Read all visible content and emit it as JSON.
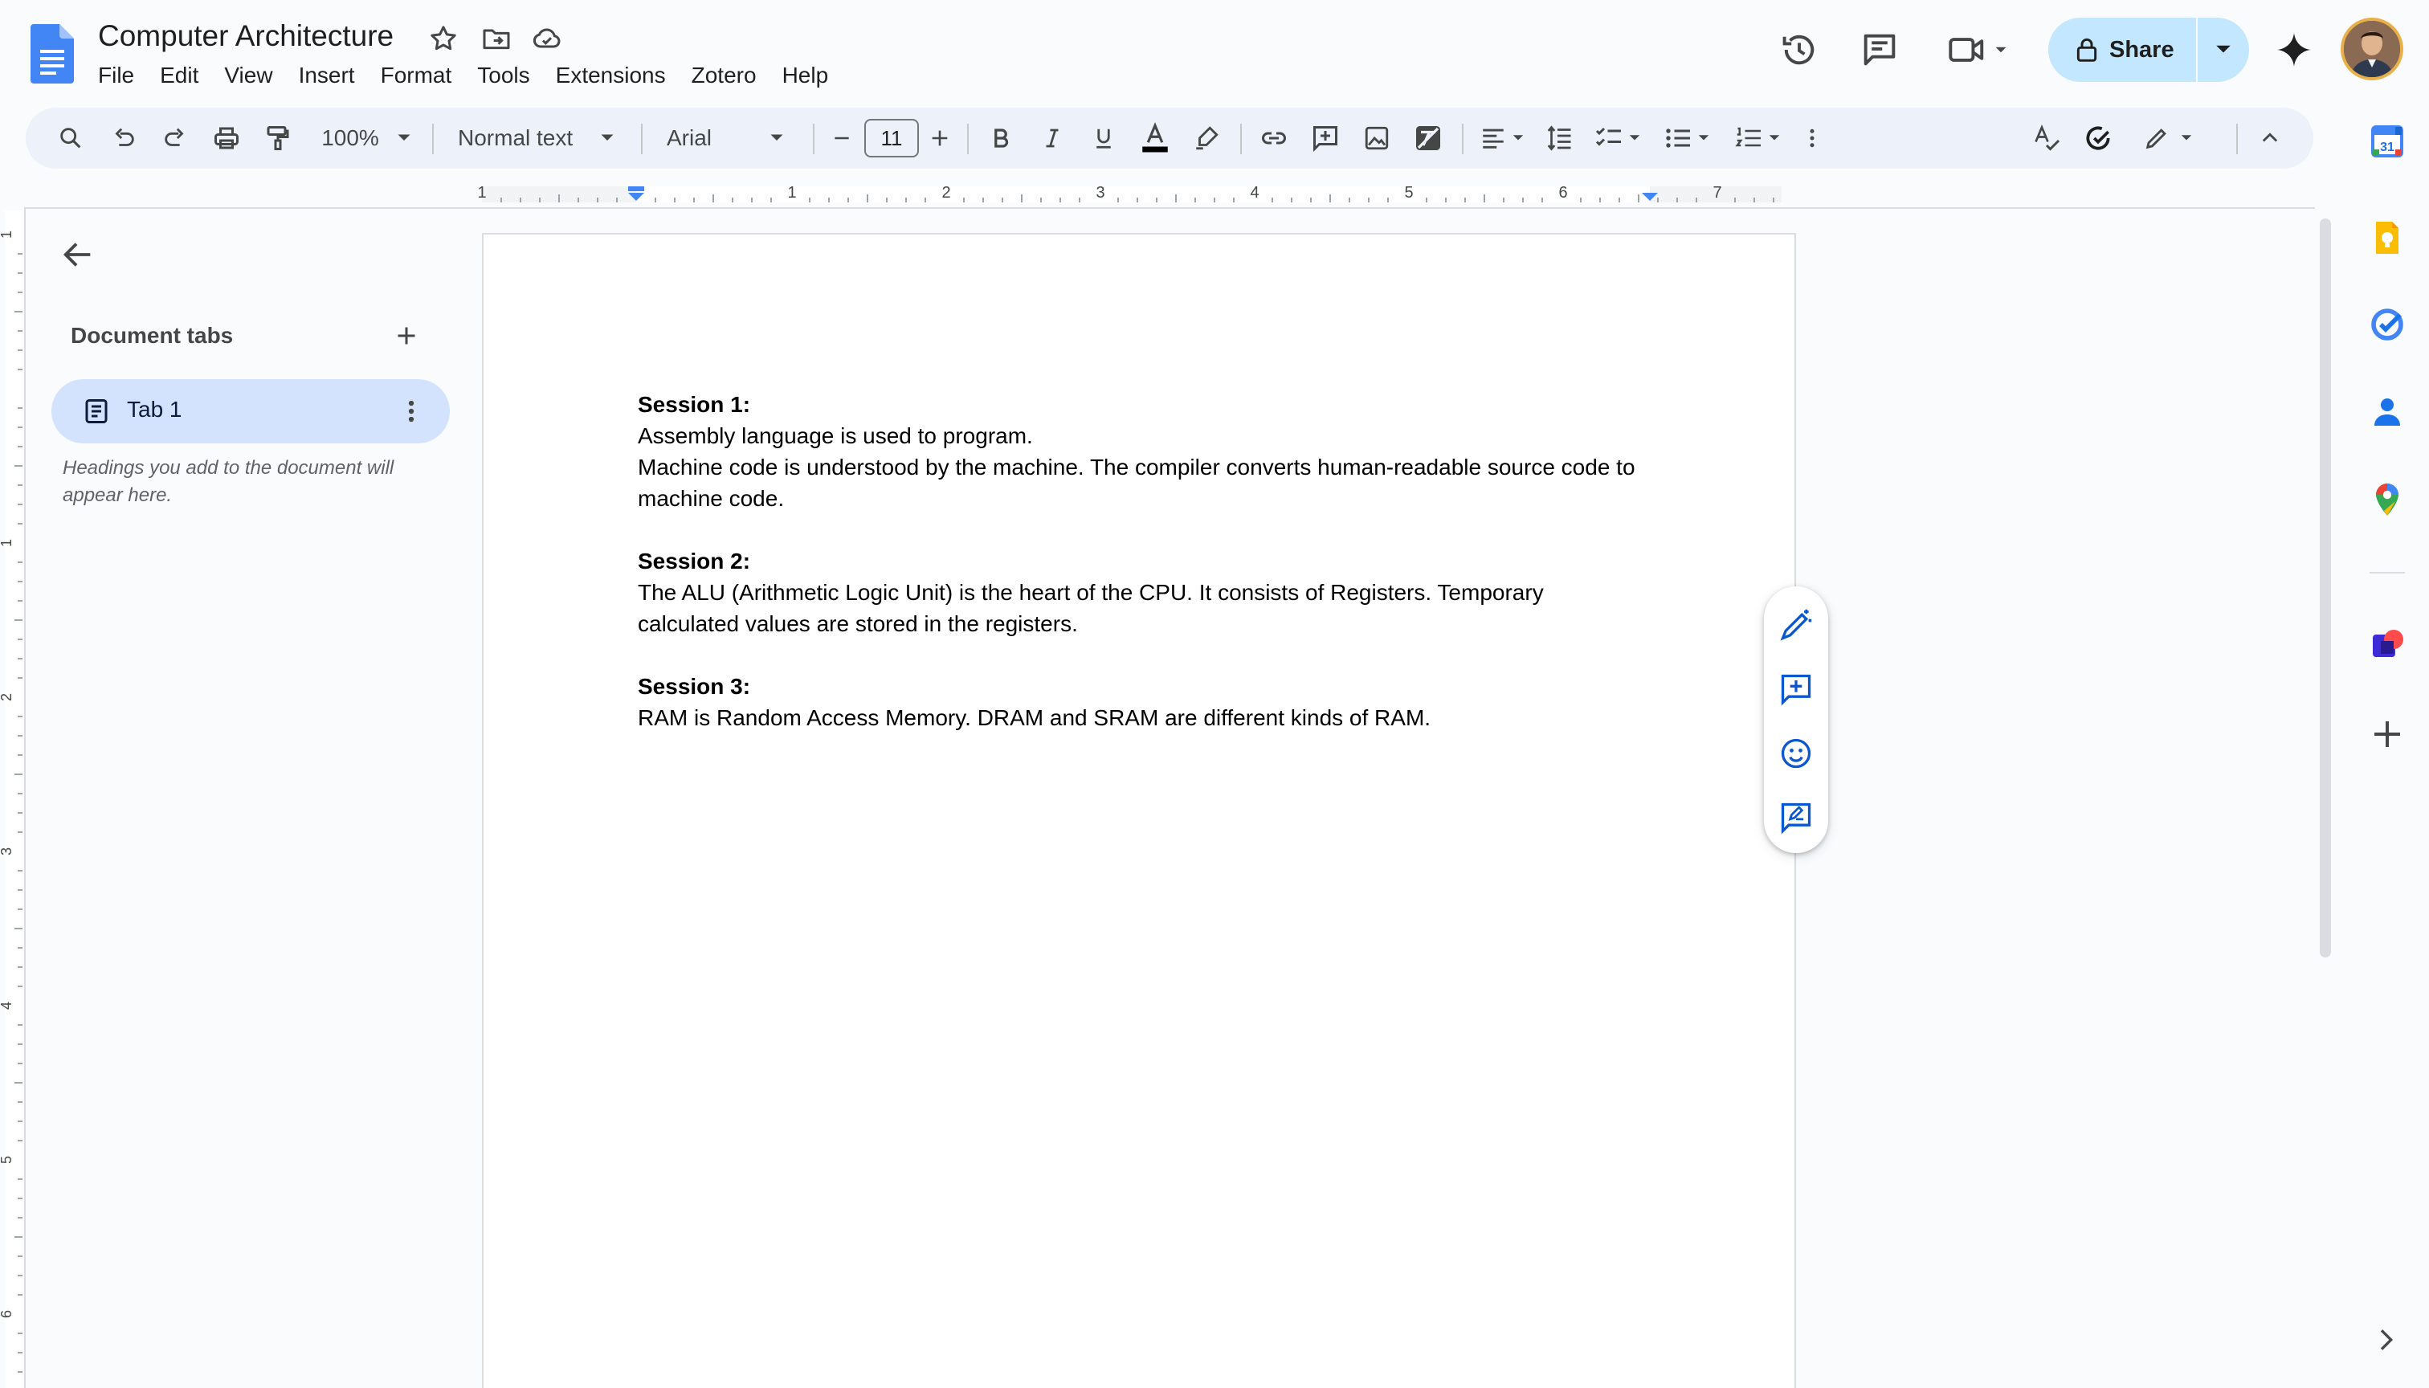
{
  "document": {
    "title": "Computer Architecture"
  },
  "menu": [
    "File",
    "Edit",
    "View",
    "Insert",
    "Format",
    "Tools",
    "Extensions",
    "Zotero",
    "Help"
  ],
  "share": {
    "label": "Share"
  },
  "toolbar": {
    "zoom": "100%",
    "paragraph_style": "Normal text",
    "font": "Arial",
    "font_size": "11"
  },
  "ruler": {
    "labels": [
      "1",
      "1",
      "2",
      "3",
      "4",
      "5",
      "6",
      "7"
    ]
  },
  "vertical_ruler": {
    "labels": [
      "1",
      "1",
      "2",
      "3",
      "4",
      "5",
      "6"
    ]
  },
  "left_panel": {
    "heading": "Document tabs",
    "tab_label": "Tab 1",
    "hint": "Headings you add to the document will appear here."
  },
  "content": {
    "sessions": [
      {
        "heading": "Session 1:",
        "lines": [
          "Assembly language is used to program.",
          "Machine code is understood by the machine. The compiler converts human-readable source code to machine code."
        ]
      },
      {
        "heading": "Session 2:",
        "lines": [
          "The ALU (Arithmetic Logic Unit) is the heart of the CPU. It consists of Registers. Temporary calculated values are stored in the registers."
        ]
      },
      {
        "heading": "Session 3:",
        "lines": [
          "RAM is Random Access Memory. DRAM and SRAM are different kinds of RAM."
        ]
      }
    ]
  },
  "colors": {
    "accent": "#0b57d0",
    "share_bg": "#c2e7ff",
    "active_tab": "#d3e3fd",
    "toolbar_bg": "#edf2fa",
    "docs_blue": "#4285f4"
  },
  "icons": {
    "header": [
      "docs-logo",
      "star-icon",
      "move-folder-icon",
      "cloud-saved-icon",
      "history-icon",
      "comments-icon",
      "meet-icon",
      "lock-icon",
      "gemini-icon"
    ],
    "toolbar": [
      "search-icon",
      "undo-icon",
      "redo-icon",
      "print-icon",
      "paint-format-icon",
      "bold-icon",
      "italic-icon",
      "underline-icon",
      "text-color-icon",
      "highlight-icon",
      "link-icon",
      "add-comment-icon",
      "insert-image-icon",
      "clear-formatting-icon",
      "align-icon",
      "line-spacing-icon",
      "checklist-icon",
      "bulleted-list-icon",
      "numbered-list-icon",
      "more-icon",
      "spellcheck-icon",
      "editing-mode-icon",
      "collapse-icon"
    ],
    "floating": [
      "help-me-write-icon",
      "add-comment-icon",
      "emoji-reaction-icon",
      "suggest-edits-icon"
    ],
    "side_panel": [
      "calendar-icon",
      "keep-icon",
      "tasks-icon",
      "contacts-icon",
      "maps-icon",
      "addon-icon",
      "add-addon-icon"
    ]
  }
}
